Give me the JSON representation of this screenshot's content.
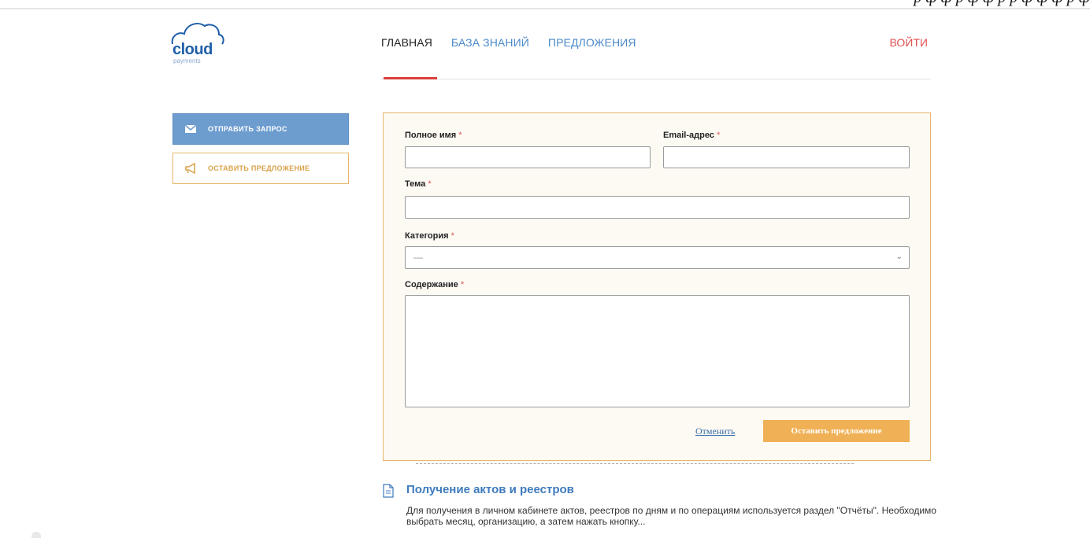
{
  "top_strip": {
    "text": "р ф ф р ф ф р р ф ф ф р ф"
  },
  "logo": {
    "word": "cloud",
    "sub": "payments"
  },
  "nav": {
    "items": [
      {
        "label": "ГЛАВНАЯ",
        "active": true
      },
      {
        "label": "БАЗА ЗНАНИЙ",
        "active": false
      },
      {
        "label": "ПРЕДЛОЖЕНИЯ",
        "active": false
      }
    ],
    "login": "ВОЙТИ"
  },
  "sidebar": {
    "send_request": "ОТПРАВИТЬ ЗАПРОС",
    "leave_suggestion": "ОСТАВИТЬ ПРЕДЛОЖЕНИЕ"
  },
  "form": {
    "full_name_label": "Полное имя",
    "email_label": "Email-адрес",
    "subject_label": "Тема",
    "category_label": "Категория",
    "content_label": "Содержание",
    "required_mark": "*",
    "full_name_value": "",
    "email_value": "",
    "subject_value": "",
    "category_value": "—",
    "content_value": "",
    "cancel": "Отменить",
    "submit": "Оставить предложение"
  },
  "article": {
    "title": "Получение актов и реестров",
    "body": "Для получения в личном кабинете актов, реестров по дням и по операциям используется раздел \"Отчёты\". Необходимо выбрать месяц, организацию, а затем нажать кнопку..."
  },
  "colors": {
    "accent_blue": "#4a89c8",
    "accent_red": "#d9413c",
    "accent_orange": "#f0b055",
    "sidebar_blue": "#6d9ccf"
  }
}
